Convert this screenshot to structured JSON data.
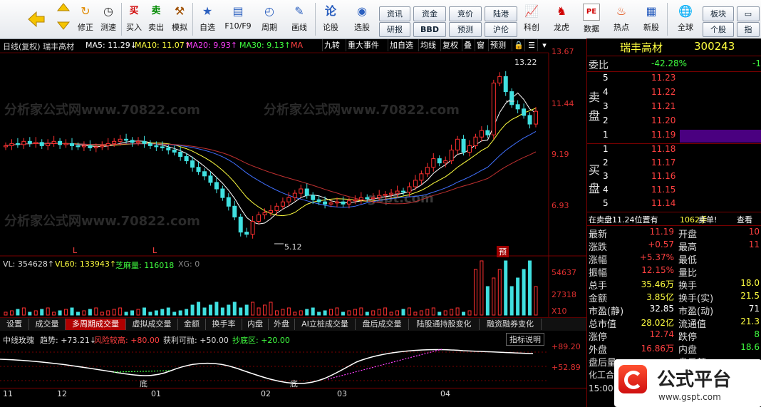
{
  "toolbar": {
    "back_label": "",
    "items": [
      {
        "label": "修正",
        "icon": "arrow-icon"
      },
      {
        "label": "测速",
        "icon": "clock-icon"
      },
      {
        "label": "买入",
        "icon": "buy-icon",
        "glyph": "买"
      },
      {
        "label": "卖出",
        "icon": "sell-icon",
        "glyph": "卖"
      },
      {
        "label": "模拟",
        "icon": "hammer-icon"
      },
      {
        "label": "自选",
        "icon": "star-icon"
      },
      {
        "label": "F10/F9",
        "icon": "f10-icon"
      },
      {
        "label": "周期",
        "icon": "cycle-icon"
      },
      {
        "label": "画线",
        "icon": "pencil-icon"
      },
      {
        "label": "论股",
        "icon": "discuss-icon",
        "glyph": "论"
      },
      {
        "label": "选股",
        "icon": "select-stock-icon"
      },
      {
        "label": "科创",
        "icon": "chart-icon"
      },
      {
        "label": "龙虎",
        "icon": "dragon-icon"
      },
      {
        "label": "数据",
        "icon": "pe-icon",
        "glyph": "PE"
      },
      {
        "label": "热点",
        "icon": "hot-icon"
      },
      {
        "label": "新股",
        "icon": "ipo-icon"
      },
      {
        "label": "全球",
        "icon": "globe-icon"
      }
    ],
    "small_buttons": [
      "资讯",
      "资金",
      "竞价",
      "陆港",
      "研报",
      "BBD",
      "预测",
      "沪伦",
      "板块",
      "个股",
      "指"
    ]
  },
  "chart": {
    "header_name": "日线(复权) 瑞丰高材",
    "ma5": "MA5: 11.29↓",
    "ma10": "MA10: 11.07↑",
    "ma20": "MA20: 9.93↑",
    "ma30": "MA30: 9.13↑",
    "ma_label": "MA",
    "menu": [
      "九转",
      "重大事件",
      "加自选",
      "均线",
      "复权",
      "叠",
      "窗",
      "预测"
    ],
    "y_labels": [
      "13.67",
      "11.44",
      "9.19",
      "6.93"
    ],
    "high_mark": "13.22",
    "low_mark": "5.12",
    "event_marks": [
      "L",
      "L"
    ],
    "forecast_mark": "预",
    "vol_header": {
      "vl": "VL: 354628↑",
      "vl60": "VL60: 133943↑",
      "zhima": "芝麻量: 116018",
      "xg": "XG: 0"
    },
    "vol_y_labels": [
      "54637",
      "27318",
      "X10"
    ],
    "tabs": [
      "设置",
      "成交量",
      "多周期成交量",
      "虚拟成交量",
      "金额",
      "换手率",
      "内盘",
      "外盘",
      "AI立桩成交量",
      "盘后成交量",
      "陆股通持股变化",
      "融资融券变化"
    ],
    "active_tab": "多周期成交量",
    "ind_header": {
      "name": "中线玫瑰",
      "trend": "趋势: +73.21↓",
      "risk": "风险较高: +80.00",
      "profit": "获利可抛: +50.00",
      "bottom": "抄底区: +20.00"
    },
    "ind_button": "指标说明",
    "ind_y_labels": [
      "+89.20",
      "+52.89"
    ],
    "ind_marks": [
      "底",
      "底"
    ],
    "x_labels": [
      "11",
      "12",
      "01",
      "02",
      "03",
      "04"
    ]
  },
  "panel": {
    "stock_name": "瑞丰高材",
    "stock_code": "300243",
    "weibi_label": "委比",
    "weibi_value": "-42.28%",
    "weibi_extra": "-1",
    "sell_label": "卖盘",
    "buy_label": "买盘",
    "asks": [
      {
        "level": "5",
        "price": "11.23"
      },
      {
        "level": "4",
        "price": "11.22"
      },
      {
        "level": "3",
        "price": "11.21"
      },
      {
        "level": "2",
        "price": "11.20"
      },
      {
        "level": "1",
        "price": "11.19"
      }
    ],
    "bids": [
      {
        "level": "1",
        "price": "11.18"
      },
      {
        "level": "2",
        "price": "11.17"
      },
      {
        "level": "3",
        "price": "11.16"
      },
      {
        "level": "4",
        "price": "11.15"
      },
      {
        "level": "5",
        "price": "11.14"
      }
    ],
    "status_line": "在卖盘11.24位置有",
    "status_qty": "1062手",
    "status_sell": "卖单!",
    "status_view": "查看",
    "stats_left": [
      {
        "label": "最新",
        "value": "11.19",
        "color": "#ff4040"
      },
      {
        "label": "涨跌",
        "value": "+0.57",
        "color": "#ff4040"
      },
      {
        "label": "涨幅",
        "value": "+5.37%",
        "color": "#ff4040"
      },
      {
        "label": "振幅",
        "value": "12.15%",
        "color": "#ff4040"
      },
      {
        "label": "总手",
        "value": "35.46万",
        "color": "#ffff40"
      },
      {
        "label": "金额",
        "value": "3.85亿",
        "color": "#ffff40"
      },
      {
        "label": "市盈(静)",
        "value": "32.85",
        "color": "#ffffff"
      },
      {
        "label": "总市值",
        "value": "28.02亿",
        "color": "#ffff40"
      },
      {
        "label": "涨停",
        "value": "12.74",
        "color": "#ff4040"
      },
      {
        "label": "外盘",
        "value": "16.86万",
        "color": "#ff4040"
      },
      {
        "label": "盘后量",
        "value": "",
        "color": "#ffffff"
      }
    ],
    "stats_right": [
      {
        "label": "开盘",
        "value": "10",
        "color": "#ff4040"
      },
      {
        "label": "最高",
        "value": "11",
        "color": "#ff4040"
      },
      {
        "label": "最低",
        "value": "",
        "color": "#ffffff"
      },
      {
        "label": "量比",
        "value": "",
        "color": "#ffffff"
      },
      {
        "label": "换手",
        "value": "18.0",
        "color": "#ffff40"
      },
      {
        "label": "换手(实)",
        "value": "21.5",
        "color": "#ffff40"
      },
      {
        "label": "市盈(动)",
        "value": "71",
        "color": "#ffffff"
      },
      {
        "label": "流通值",
        "value": "21.3",
        "color": "#ffff40"
      },
      {
        "label": "跌停",
        "value": "8",
        "color": "#40ff40"
      },
      {
        "label": "内盘",
        "value": "18.6",
        "color": "#40ff40"
      },
      {
        "label": "盘后额",
        "value": "",
        "color": "#ffffff"
      }
    ],
    "bottom_label": "化工合",
    "time": "15:00",
    "logo_text": "公式平台",
    "logo_url": "www.gspt.com"
  },
  "watermarks": [
    "分析家公式网www.70822.com",
    "分析家公式网www.70822.com",
    "分析家公式网www.70822.com",
    "gspt.com"
  ],
  "colors": {
    "up": "#ff3030",
    "down": "#40e0e0",
    "ma5": "#ffffff",
    "ma10": "#ffff40",
    "ma20": "#ff40ff",
    "ma30": "#40ff40"
  },
  "chart_data": {
    "type": "candlestick",
    "y_range": [
      5.12,
      13.67
    ],
    "high": 13.22,
    "low": 5.12,
    "closes": [
      9.6,
      9.7,
      9.65,
      9.8,
      9.7,
      9.75,
      9.6,
      9.7,
      9.8,
      9.65,
      9.7,
      9.6,
      9.55,
      9.6,
      9.5,
      9.55,
      9.6,
      9.7,
      9.8,
      9.9,
      9.85,
      9.75,
      9.8,
      9.7,
      9.6,
      9.55,
      9.5,
      9.4,
      9.3,
      9.1,
      8.9,
      8.6,
      8.4,
      8.2,
      7.9,
      7.6,
      7.2,
      6.8,
      6.3,
      5.6,
      5.5,
      6.1,
      6.4,
      6.5,
      6.6,
      6.8,
      7.0,
      7.2,
      7.4,
      7.6,
      7.3,
      7.1,
      7.0,
      6.9,
      6.95,
      7.0,
      6.9,
      7.05,
      7.1,
      7.2,
      7.15,
      7.2,
      7.3,
      7.35,
      7.4,
      7.5,
      7.45,
      7.7,
      8.0,
      8.3,
      8.6,
      9.0,
      8.8,
      8.9,
      9.4,
      9.9,
      9.3,
      9.6,
      10.0,
      10.3,
      10.1,
      12.5,
      12.8,
      12.1,
      11.5,
      11.3,
      11.0,
      10.6,
      11.19
    ]
  }
}
